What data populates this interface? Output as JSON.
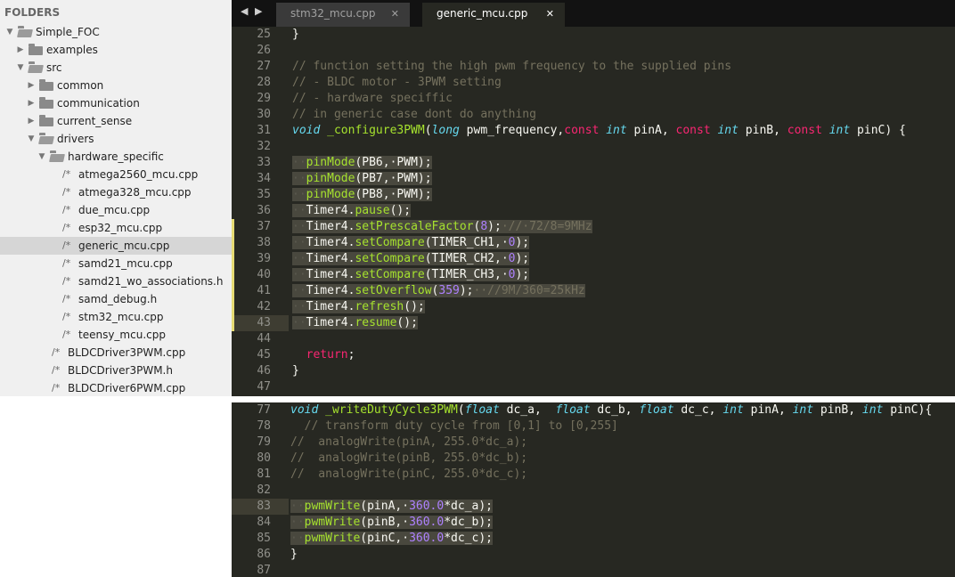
{
  "sidebar": {
    "header": "FOLDERS",
    "items": [
      {
        "label": "Simple_FOC",
        "type": "folder",
        "expanded": true,
        "depth": 0
      },
      {
        "label": "examples",
        "type": "folder",
        "expanded": false,
        "depth": 1
      },
      {
        "label": "src",
        "type": "folder",
        "expanded": true,
        "depth": 1
      },
      {
        "label": "common",
        "type": "folder",
        "expanded": false,
        "depth": 2
      },
      {
        "label": "communication",
        "type": "folder",
        "expanded": false,
        "depth": 2
      },
      {
        "label": "current_sense",
        "type": "folder",
        "expanded": false,
        "depth": 2
      },
      {
        "label": "drivers",
        "type": "folder",
        "expanded": true,
        "depth": 2
      },
      {
        "label": "hardware_specific",
        "type": "folder",
        "expanded": true,
        "depth": 3
      },
      {
        "label": "atmega2560_mcu.cpp",
        "type": "file",
        "depth": 4
      },
      {
        "label": "atmega328_mcu.cpp",
        "type": "file",
        "depth": 4
      },
      {
        "label": "due_mcu.cpp",
        "type": "file",
        "depth": 4
      },
      {
        "label": "esp32_mcu.cpp",
        "type": "file",
        "depth": 4
      },
      {
        "label": "generic_mcu.cpp",
        "type": "file",
        "depth": 4,
        "selected": true
      },
      {
        "label": "samd21_mcu.cpp",
        "type": "file",
        "depth": 4
      },
      {
        "label": "samd21_wo_associations.h",
        "type": "file",
        "depth": 4
      },
      {
        "label": "samd_debug.h",
        "type": "file",
        "depth": 4
      },
      {
        "label": "stm32_mcu.cpp",
        "type": "file",
        "depth": 4
      },
      {
        "label": "teensy_mcu.cpp",
        "type": "file",
        "depth": 4
      },
      {
        "label": "BLDCDriver3PWM.cpp",
        "type": "file",
        "depth": 3
      },
      {
        "label": "BLDCDriver3PWM.h",
        "type": "file",
        "depth": 3
      },
      {
        "label": "BLDCDriver6PWM.cpp",
        "type": "file",
        "depth": 3
      }
    ]
  },
  "tabs": {
    "nav": "◀ ▶",
    "close_glyph": "✕",
    "items": [
      {
        "label": "stm32_mcu.cpp",
        "active": false
      },
      {
        "label": "generic_mcu.cpp",
        "active": true
      }
    ]
  },
  "icons": {
    "folder": "folder-icon",
    "file": "comment-file-icon",
    "expanded": "triangle-down-icon",
    "collapsed": "triangle-right-icon"
  },
  "colors": {
    "editor_bg": "#272822",
    "sidebar_bg": "#f0f0f0",
    "keyword": "#66d9ef",
    "function": "#a6e22e",
    "number": "#ae81ff",
    "comment": "#75715e",
    "return": "#f92672",
    "modified_marker": "#e6db74"
  },
  "top_pane": [
    {
      "n": "25",
      "tokens": [
        [
          "}",
          ""
        ]
      ]
    },
    {
      "n": "26",
      "tokens": []
    },
    {
      "n": "27",
      "tokens": [
        [
          "// function setting the high pwm frequency to the supplied pins",
          "cm"
        ]
      ]
    },
    {
      "n": "28",
      "tokens": [
        [
          "// - BLDC motor - 3PWM setting",
          "cm"
        ]
      ]
    },
    {
      "n": "29",
      "tokens": [
        [
          "// - hardware speciffic",
          "cm"
        ]
      ]
    },
    {
      "n": "30",
      "tokens": [
        [
          "// in generic case dont do anything",
          "cm"
        ]
      ]
    },
    {
      "n": "31",
      "tokens": [
        [
          "void",
          "kw"
        ],
        [
          " ",
          ""
        ],
        [
          "_configure3PWM",
          "fn"
        ],
        [
          "(",
          ""
        ],
        [
          "long",
          "kw"
        ],
        [
          " pwm_frequency,",
          ""
        ],
        [
          "const",
          "ret"
        ],
        [
          " ",
          ""
        ],
        [
          "int",
          "kw"
        ],
        [
          " pinA, ",
          ""
        ],
        [
          "const",
          "ret"
        ],
        [
          " ",
          ""
        ],
        [
          "int",
          "kw"
        ],
        [
          " pinB, ",
          ""
        ],
        [
          "const",
          "ret"
        ],
        [
          " ",
          ""
        ],
        [
          "int",
          "kw"
        ],
        [
          " pinC) {",
          ""
        ]
      ]
    },
    {
      "n": "32",
      "tokens": []
    },
    {
      "n": "33",
      "sel": true,
      "tokens": [
        [
          "··",
          "ws"
        ],
        [
          "pinMode",
          "fn"
        ],
        [
          "(PB6,·PWM);",
          ""
        ]
      ]
    },
    {
      "n": "34",
      "sel": true,
      "tokens": [
        [
          "··",
          "ws"
        ],
        [
          "pinMode",
          "fn"
        ],
        [
          "(PB7,·PWM);",
          ""
        ]
      ]
    },
    {
      "n": "35",
      "sel": true,
      "tokens": [
        [
          "··",
          "ws"
        ],
        [
          "pinMode",
          "fn"
        ],
        [
          "(PB8,·PWM);",
          ""
        ]
      ]
    },
    {
      "n": "36",
      "sel": true,
      "tokens": [
        [
          "··",
          "ws"
        ],
        [
          "Timer4.",
          ""
        ],
        [
          "pause",
          "fn"
        ],
        [
          "();",
          ""
        ]
      ]
    },
    {
      "n": "37",
      "sel": true,
      "mod": true,
      "tokens": [
        [
          "··",
          "ws"
        ],
        [
          "Timer4.",
          ""
        ],
        [
          "setPrescaleFactor",
          "fn"
        ],
        [
          "(",
          ""
        ],
        [
          "8",
          "nm"
        ],
        [
          ");",
          ""
        ],
        [
          "·//·72/8=9MHz",
          "cm"
        ]
      ]
    },
    {
      "n": "38",
      "sel": true,
      "mod": true,
      "tokens": [
        [
          "··",
          "ws"
        ],
        [
          "Timer4.",
          ""
        ],
        [
          "setCompare",
          "fn"
        ],
        [
          "(TIMER_CH1,·",
          ""
        ],
        [
          "0",
          "nm"
        ],
        [
          ");",
          ""
        ]
      ]
    },
    {
      "n": "39",
      "sel": true,
      "mod": true,
      "tokens": [
        [
          "··",
          "ws"
        ],
        [
          "Timer4.",
          ""
        ],
        [
          "setCompare",
          "fn"
        ],
        [
          "(TIMER_CH2,·",
          ""
        ],
        [
          "0",
          "nm"
        ],
        [
          ");",
          ""
        ]
      ]
    },
    {
      "n": "40",
      "sel": true,
      "mod": true,
      "tokens": [
        [
          "··",
          "ws"
        ],
        [
          "Timer4.",
          ""
        ],
        [
          "setCompare",
          "fn"
        ],
        [
          "(TIMER_CH3,·",
          ""
        ],
        [
          "0",
          "nm"
        ],
        [
          ");",
          ""
        ]
      ]
    },
    {
      "n": "41",
      "sel": true,
      "mod": true,
      "tokens": [
        [
          "··",
          "ws"
        ],
        [
          "Timer4.",
          ""
        ],
        [
          "setOverflow",
          "fn"
        ],
        [
          "(",
          ""
        ],
        [
          "359",
          "nm"
        ],
        [
          ");",
          ""
        ],
        [
          "··//9M/360=25kHz",
          "cm"
        ]
      ]
    },
    {
      "n": "42",
      "sel": true,
      "mod": true,
      "tokens": [
        [
          "··",
          "ws"
        ],
        [
          "Timer4.",
          ""
        ],
        [
          "refresh",
          "fn"
        ],
        [
          "();",
          ""
        ]
      ]
    },
    {
      "n": "43",
      "sel": true,
      "mod": true,
      "hl": true,
      "tokens": [
        [
          "··",
          "ws"
        ],
        [
          "Timer4.",
          ""
        ],
        [
          "resume",
          "fn"
        ],
        [
          "();",
          ""
        ]
      ]
    },
    {
      "n": "44",
      "tokens": []
    },
    {
      "n": "45",
      "tokens": [
        [
          "  ",
          ""
        ],
        [
          "return",
          "ret"
        ],
        [
          ";",
          ""
        ]
      ]
    },
    {
      "n": "46",
      "tokens": [
        [
          "}",
          ""
        ]
      ]
    },
    {
      "n": "47",
      "tokens": []
    }
  ],
  "bottom_pane": [
    {
      "n": "77",
      "tokens": [
        [
          "void",
          "kw"
        ],
        [
          " ",
          ""
        ],
        [
          "_writeDutyCycle3PWM",
          "fn"
        ],
        [
          "(",
          ""
        ],
        [
          "float",
          "kw"
        ],
        [
          " dc_a,  ",
          ""
        ],
        [
          "float",
          "kw"
        ],
        [
          " dc_b, ",
          ""
        ],
        [
          "float",
          "kw"
        ],
        [
          " dc_c, ",
          ""
        ],
        [
          "int",
          "kw"
        ],
        [
          " pinA, ",
          ""
        ],
        [
          "int",
          "kw"
        ],
        [
          " pinB, ",
          ""
        ],
        [
          "int",
          "kw"
        ],
        [
          " pinC){",
          ""
        ]
      ]
    },
    {
      "n": "78",
      "tokens": [
        [
          "  // transform duty cycle from [0,1] to [0,255]",
          "cm"
        ]
      ]
    },
    {
      "n": "79",
      "tokens": [
        [
          "//  analogWrite(pinA, 255.0*dc_a);",
          "cm"
        ]
      ]
    },
    {
      "n": "80",
      "tokens": [
        [
          "//  analogWrite(pinB, 255.0*dc_b);",
          "cm"
        ]
      ]
    },
    {
      "n": "81",
      "tokens": [
        [
          "//  analogWrite(pinC, 255.0*dc_c);",
          "cm"
        ]
      ]
    },
    {
      "n": "82",
      "tokens": []
    },
    {
      "n": "83",
      "sel": true,
      "hl": true,
      "tokens": [
        [
          "··",
          "ws"
        ],
        [
          "pwmWrite",
          "fn"
        ],
        [
          "(pinA,·",
          ""
        ],
        [
          "360.0",
          "nm"
        ],
        [
          "*dc_a);",
          ""
        ]
      ]
    },
    {
      "n": "84",
      "sel": true,
      "tokens": [
        [
          "··",
          "ws"
        ],
        [
          "pwmWrite",
          "fn"
        ],
        [
          "(pinB,·",
          ""
        ],
        [
          "360.0",
          "nm"
        ],
        [
          "*dc_b);",
          ""
        ]
      ]
    },
    {
      "n": "85",
      "sel": true,
      "tokens": [
        [
          "··",
          "ws"
        ],
        [
          "pwmWrite",
          "fn"
        ],
        [
          "(pinC,·",
          ""
        ],
        [
          "360.0",
          "nm"
        ],
        [
          "*dc_c);",
          ""
        ]
      ]
    },
    {
      "n": "86",
      "tokens": [
        [
          "}",
          ""
        ]
      ]
    },
    {
      "n": "87",
      "tokens": []
    }
  ]
}
